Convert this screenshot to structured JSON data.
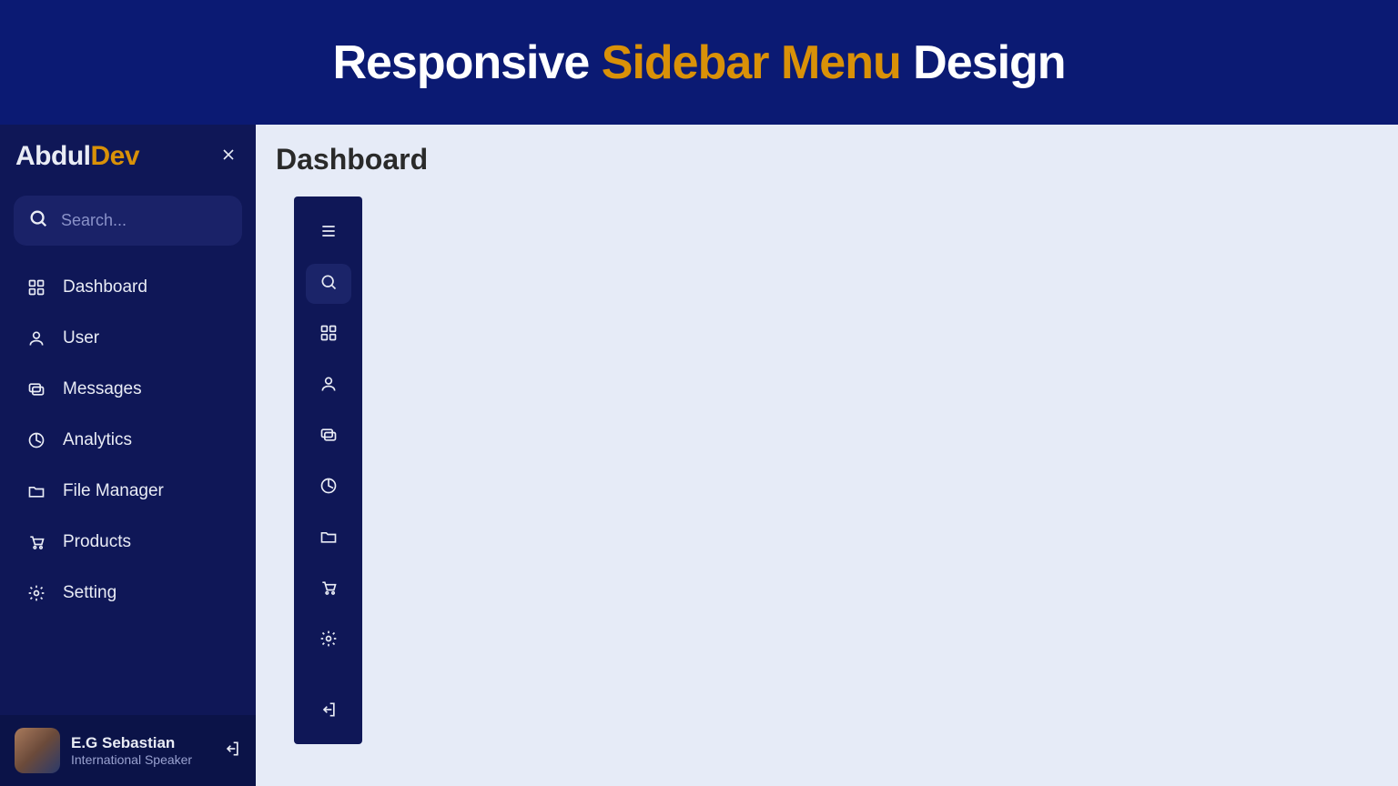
{
  "banner": {
    "title_pre": "Responsive ",
    "title_accent": "Sidebar Menu",
    "title_post": " Design"
  },
  "logo": {
    "part1": "Abdul",
    "part2": "Dev"
  },
  "search": {
    "placeholder": "Search..."
  },
  "sidebar": {
    "items": [
      {
        "icon": "dashboard-icon",
        "label": "Dashboard"
      },
      {
        "icon": "user-icon",
        "label": "User"
      },
      {
        "icon": "messages-icon",
        "label": "Messages"
      },
      {
        "icon": "analytics-icon",
        "label": "Analytics"
      },
      {
        "icon": "folder-icon",
        "label": "File Manager"
      },
      {
        "icon": "cart-icon",
        "label": "Products"
      },
      {
        "icon": "gear-icon",
        "label": "Setting"
      }
    ]
  },
  "user": {
    "name": "E.G Sebastian",
    "role": "International Speaker"
  },
  "page": {
    "title": "Dashboard"
  },
  "mini": {
    "items": [
      {
        "icon": "hamburger-icon"
      },
      {
        "icon": "search-icon",
        "highlight": true
      },
      {
        "icon": "dashboard-icon"
      },
      {
        "icon": "user-icon"
      },
      {
        "icon": "messages-icon"
      },
      {
        "icon": "analytics-icon"
      },
      {
        "icon": "folder-icon"
      },
      {
        "icon": "cart-icon"
      },
      {
        "icon": "gear-icon"
      },
      {
        "icon": "logout-icon"
      }
    ]
  },
  "colors": {
    "accent": "#d99108",
    "sidebar": "#0f1757",
    "banner": "#0b1a73"
  }
}
